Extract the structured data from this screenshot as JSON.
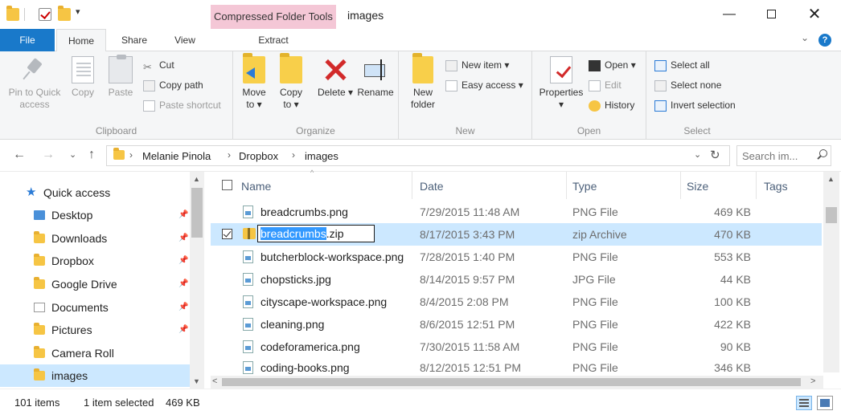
{
  "window": {
    "title": "images",
    "contextual_tab_group": "Compressed Folder Tools",
    "quick_access_toolbar": {
      "dropdown_glyph": "▾"
    },
    "controls": {
      "minimize": "—",
      "close": "✕"
    }
  },
  "ribbon_tabs": {
    "file": "File",
    "home": "Home",
    "share": "Share",
    "view": "View",
    "extract": "Extract",
    "help": "?",
    "collapse": "⌄"
  },
  "ribbon": {
    "clipboard": {
      "label": "Clipboard",
      "pin_to_quick_access": "Pin to Quick access",
      "copy": "Copy",
      "paste": "Paste",
      "cut": "Cut",
      "copy_path": "Copy path",
      "paste_shortcut": "Paste shortcut"
    },
    "organize": {
      "label": "Organize",
      "move_to": "Move to ▾",
      "copy_to": "Copy to ▾",
      "delete": "Delete ▾",
      "rename": "Rename"
    },
    "new": {
      "label": "New",
      "new_folder": "New folder",
      "new_item": "New item ▾",
      "easy_access": "Easy access ▾"
    },
    "open": {
      "label": "Open",
      "properties": "Properties ▾",
      "open": "Open ▾",
      "edit": "Edit",
      "history": "History"
    },
    "select": {
      "label": "Select",
      "select_all": "Select all",
      "select_none": "Select none",
      "invert_selection": "Invert selection"
    }
  },
  "address_bar": {
    "back": "←",
    "forward": "→",
    "recent": "⌄",
    "up": "↑",
    "breadcrumbs": [
      "Melanie Pinola",
      "Dropbox",
      "images"
    ],
    "separator": "›",
    "dropdown": "⌄",
    "refresh": "↻",
    "search_placeholder": "Search im..."
  },
  "navigation": {
    "quick_access": "Quick access",
    "items": [
      {
        "label": "Desktop",
        "pinned": true
      },
      {
        "label": "Downloads",
        "pinned": true
      },
      {
        "label": "Dropbox",
        "pinned": true
      },
      {
        "label": "Google Drive",
        "pinned": true
      },
      {
        "label": "Documents",
        "pinned": true
      },
      {
        "label": "Pictures",
        "pinned": true
      },
      {
        "label": "Camera Roll",
        "pinned": false
      },
      {
        "label": "images",
        "pinned": false,
        "selected": true
      }
    ],
    "pin_glyph": "📌"
  },
  "file_list": {
    "columns": {
      "name": "Name",
      "date": "Date",
      "type": "Type",
      "size": "Size",
      "tags": "Tags"
    },
    "sort_indicator": "^",
    "rows": [
      {
        "name": "breadcrumbs.png",
        "date": "7/29/2015 11:48 AM",
        "type": "PNG File",
        "size": "469 KB"
      },
      {
        "name": "breadcrumbs.zip",
        "date": "8/17/2015 3:43 PM",
        "type": "zip Archive",
        "size": "470 KB",
        "selected": true,
        "rename_selected": "breadcrumbs",
        "rename_rest": ".zip"
      },
      {
        "name": "butcherblock-workspace.png",
        "date": "7/28/2015 1:40 PM",
        "type": "PNG File",
        "size": "553 KB"
      },
      {
        "name": "chopsticks.jpg",
        "date": "8/14/2015 9:57 PM",
        "type": "JPG File",
        "size": "44 KB"
      },
      {
        "name": "cityscape-workspace.png",
        "date": "8/4/2015 2:08 PM",
        "type": "PNG File",
        "size": "100 KB"
      },
      {
        "name": "cleaning.png",
        "date": "8/6/2015 12:51 PM",
        "type": "PNG File",
        "size": "422 KB"
      },
      {
        "name": "codeforamerica.png",
        "date": "7/30/2015 11:58 AM",
        "type": "PNG File",
        "size": "90 KB"
      },
      {
        "name": "coding-books.png",
        "date": "8/12/2015 12:51 PM",
        "type": "PNG File",
        "size": "346 KB"
      }
    ],
    "scroll_up": "▲",
    "scroll_down": "▼",
    "scroll_left": "<",
    "scroll_right": ">"
  },
  "status_bar": {
    "item_count": "101 items",
    "selection": "1 item selected",
    "selection_size": "469 KB"
  },
  "icons": {
    "cut": "✂",
    "window_close": "close-icon",
    "file": "png-file-icon",
    "zip": "zip-folder-icon"
  },
  "colors": {
    "file_tab": "#1979ca",
    "contextual_tab": "#f4c7d6",
    "selection": "#cce8ff",
    "rename_highlight": "#3399ff",
    "delete_red": "#d22a2a"
  }
}
